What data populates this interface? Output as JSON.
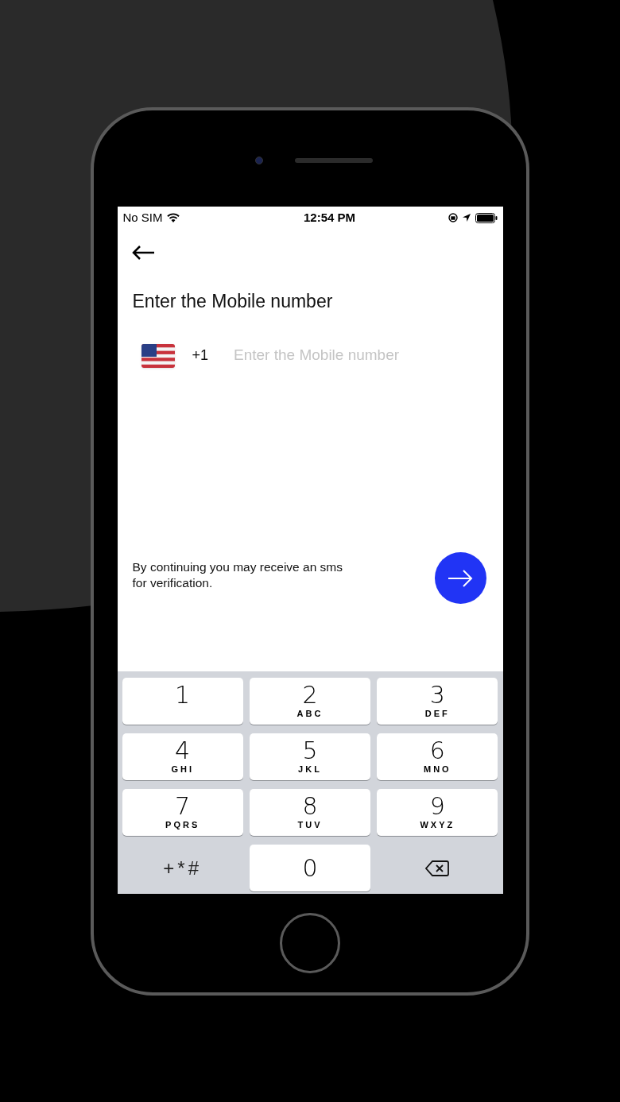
{
  "status_bar": {
    "carrier": "No SIM",
    "time": "12:54 PM"
  },
  "title": "Enter the Mobile number",
  "phone_field": {
    "country_code": "+1",
    "placeholder": "Enter the Mobile number"
  },
  "notice": "By continuing you may receive an sms for verification.",
  "keypad": [
    {
      "kind": "digit",
      "digit": "1"
    },
    {
      "kind": "digit",
      "digit": "2",
      "letters": "ABC"
    },
    {
      "kind": "digit",
      "digit": "3",
      "letters": "DEF"
    },
    {
      "kind": "digit",
      "digit": "4",
      "letters": "GHI"
    },
    {
      "kind": "digit",
      "digit": "5",
      "letters": "JKL"
    },
    {
      "kind": "digit",
      "digit": "6",
      "letters": "MNO"
    },
    {
      "kind": "digit",
      "digit": "7",
      "letters": "PQRS"
    },
    {
      "kind": "digit",
      "digit": "8",
      "letters": "TUV"
    },
    {
      "kind": "digit",
      "digit": "9",
      "letters": "WXYZ"
    },
    {
      "kind": "symbols",
      "digit": "+*#"
    },
    {
      "kind": "digit",
      "digit": "0"
    },
    {
      "kind": "delete"
    }
  ]
}
